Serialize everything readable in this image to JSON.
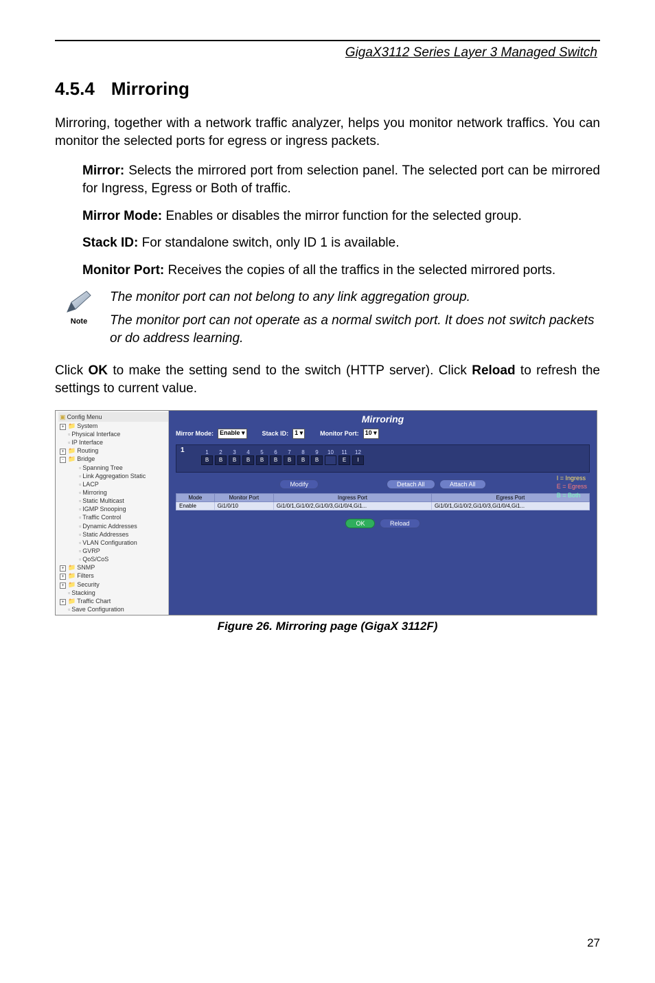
{
  "running_header": "GigaX3112 Series Layer 3 Managed Switch",
  "section": {
    "number": "4.5.4",
    "title": "Mirroring"
  },
  "intro": "Mirroring, together with a network traffic analyzer, helps you monitor network traffics. You can monitor the selected ports for egress or ingress packets.",
  "defs": [
    {
      "term": "Mirror:",
      "desc": " Selects the mirrored port from selection panel. The selected port can be mirrored for Ingress, Egress or Both of traffic."
    },
    {
      "term": "Mirror Mode:",
      "desc": " Enables or disables the mirror function for the selected group."
    },
    {
      "term": "Stack ID:",
      "desc": " For standalone switch, only ID 1 is available."
    },
    {
      "term": "Monitor Port:",
      "desc": " Receives the copies of all the traffics in the selected mirrored ports."
    }
  ],
  "note": {
    "label": "Note",
    "line1": "The monitor port can not belong to any link aggregation group.",
    "line2": "The monitor port can not operate as a normal switch port. It does not switch packets or do address learning."
  },
  "outro_pre": "Click ",
  "outro_ok": "OK",
  "outro_mid": " to make the setting send to the switch (HTTP server). Click ",
  "outro_reload": "Reload",
  "outro_post": " to refresh the settings to current value.",
  "fig": {
    "caption": "Figure 26. Mirroring page (GigaX 3112F)",
    "tree": {
      "title": "Config Menu",
      "items": [
        {
          "t": "System",
          "kind": "folder",
          "ind": 0,
          "toggle": "+"
        },
        {
          "t": "Physical Interface",
          "kind": "page",
          "ind": 1
        },
        {
          "t": "IP Interface",
          "kind": "page",
          "ind": 1
        },
        {
          "t": "Routing",
          "kind": "folder",
          "ind": 0,
          "toggle": "+"
        },
        {
          "t": "Bridge",
          "kind": "folder",
          "ind": 0,
          "toggle": "-"
        },
        {
          "t": "Spanning Tree",
          "kind": "page",
          "ind": 2
        },
        {
          "t": "Link Aggregation Static",
          "kind": "page",
          "ind": 2
        },
        {
          "t": "LACP",
          "kind": "page",
          "ind": 2
        },
        {
          "t": "Mirroring",
          "kind": "page",
          "ind": 2,
          "sel": true
        },
        {
          "t": "Static Multicast",
          "kind": "page",
          "ind": 2
        },
        {
          "t": "IGMP Snooping",
          "kind": "page",
          "ind": 2
        },
        {
          "t": "Traffic Control",
          "kind": "page",
          "ind": 2
        },
        {
          "t": "Dynamic Addresses",
          "kind": "page",
          "ind": 2
        },
        {
          "t": "Static Addresses",
          "kind": "page",
          "ind": 2
        },
        {
          "t": "VLAN Configuration",
          "kind": "page",
          "ind": 2
        },
        {
          "t": "GVRP",
          "kind": "page",
          "ind": 2
        },
        {
          "t": "QoS/CoS",
          "kind": "page",
          "ind": 2
        },
        {
          "t": "SNMP",
          "kind": "folder",
          "ind": 0,
          "toggle": "+"
        },
        {
          "t": "Filters",
          "kind": "folder",
          "ind": 0,
          "toggle": "+"
        },
        {
          "t": "Security",
          "kind": "folder",
          "ind": 0,
          "toggle": "+"
        },
        {
          "t": "Stacking",
          "kind": "page",
          "ind": 1
        },
        {
          "t": "Traffic Chart",
          "kind": "folder",
          "ind": 0,
          "toggle": "+"
        },
        {
          "t": "Save Configuration",
          "kind": "page",
          "ind": 1
        }
      ]
    },
    "panel": {
      "title": "Mirroring",
      "mirror_mode_label": "Mirror Mode:",
      "mirror_mode_value": "Enable",
      "stack_id_label": "Stack ID:",
      "stack_id_value": "1",
      "monitor_port_label": "Monitor Port:",
      "monitor_port_value": "10",
      "lead": "1",
      "port_numbers": [
        "1",
        "2",
        "3",
        "4",
        "5",
        "6",
        "7",
        "8",
        "9",
        "10",
        "11",
        "12"
      ],
      "port_states": [
        "B",
        "B",
        "B",
        "B",
        "B",
        "B",
        "B",
        "B",
        "B",
        "",
        "E",
        "I"
      ],
      "legend": {
        "i": "I = Ingress",
        "e": "E = Egress",
        "b": "B = Both"
      },
      "buttons": {
        "modify": "Modify",
        "detach": "Detach All",
        "attach": "Attach All",
        "ok": "OK",
        "reload": "Reload"
      },
      "table": {
        "headers": [
          "Mode",
          "Monitor Port",
          "Ingress Port",
          "Egress Port"
        ],
        "row": [
          "Enable",
          "Gi1/0/10",
          "Gi1/0/1,Gi1/0/2,Gi1/0/3,Gi1/0/4,Gi1...",
          "Gi1/0/1,Gi1/0/2,Gi1/0/3,Gi1/0/4,Gi1..."
        ]
      }
    }
  },
  "page_number": "27"
}
